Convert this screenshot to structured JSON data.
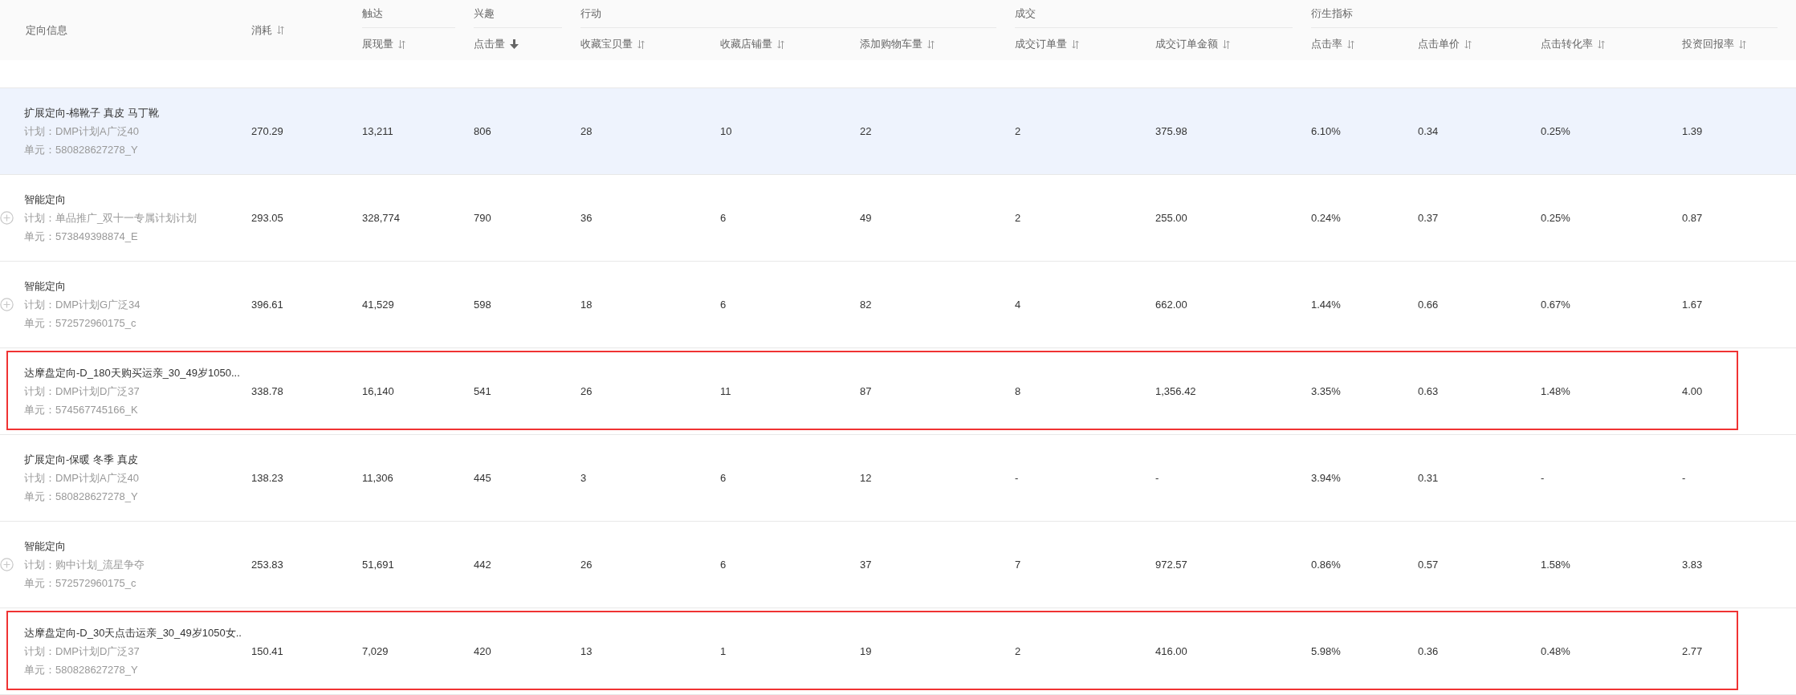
{
  "columns": [
    {
      "label": "定向信息",
      "sortable": false
    },
    {
      "label": "消耗",
      "sortable": true,
      "sorted_descending": false
    }
  ],
  "column_groups": [
    {
      "label": "触达",
      "columns": [
        {
          "label": "展现量",
          "sortable": true,
          "sorted_descending": false
        }
      ]
    },
    {
      "label": "兴趣",
      "columns": [
        {
          "label": "点击量",
          "sortable": true,
          "sorted_descending": true
        }
      ]
    },
    {
      "label": "行动",
      "columns": [
        {
          "label": "收藏宝贝量",
          "sortable": true,
          "sorted_descending": false
        },
        {
          "label": "收藏店铺量",
          "sortable": true,
          "sorted_descending": false
        },
        {
          "label": "添加购物车量",
          "sortable": true,
          "sorted_descending": false
        }
      ]
    },
    {
      "label": "成交",
      "columns": [
        {
          "label": "成交订单量",
          "sortable": true,
          "sorted_descending": false
        },
        {
          "label": "成交订单金额",
          "sortable": true,
          "sorted_descending": false
        }
      ]
    },
    {
      "label": "衍生指标",
      "columns": [
        {
          "label": "点击率",
          "sortable": true,
          "sorted_descending": false
        },
        {
          "label": "点击单价",
          "sortable": true,
          "sorted_descending": false
        },
        {
          "label": "点击转化率",
          "sortable": true,
          "sorted_descending": false
        },
        {
          "label": "投资回报率",
          "sortable": true,
          "sorted_descending": false
        }
      ]
    }
  ],
  "rows": [
    {
      "name": "扩展定向-棉靴子 真皮 马丁靴",
      "plan": "计划：DMP计划A广泛40",
      "unit": "单元：580828627278_Y",
      "expandable": false,
      "highlighted": true,
      "outlined": false,
      "values": [
        "270.29",
        "13,211",
        "806",
        "28",
        "10",
        "22",
        "2",
        "375.98",
        "6.10%",
        "0.34",
        "0.25%",
        "1.39"
      ]
    },
    {
      "name": "智能定向",
      "plan": "计划：单品推广_双十一专属计划计划",
      "unit": "单元：573849398874_E",
      "expandable": true,
      "highlighted": false,
      "outlined": false,
      "values": [
        "293.05",
        "328,774",
        "790",
        "36",
        "6",
        "49",
        "2",
        "255.00",
        "0.24%",
        "0.37",
        "0.25%",
        "0.87"
      ]
    },
    {
      "name": "智能定向",
      "plan": "计划：DMP计划G广泛34",
      "unit": "单元：572572960175_c",
      "expandable": true,
      "highlighted": false,
      "outlined": false,
      "values": [
        "396.61",
        "41,529",
        "598",
        "18",
        "6",
        "82",
        "4",
        "662.00",
        "1.44%",
        "0.66",
        "0.67%",
        "1.67"
      ]
    },
    {
      "name": "达摩盘定向-D_180天购买运亲_30_49岁1050...",
      "plan": "计划：DMP计划D广泛37",
      "unit": "单元：574567745166_K",
      "expandable": false,
      "highlighted": false,
      "outlined": true,
      "values": [
        "338.78",
        "16,140",
        "541",
        "26",
        "11",
        "87",
        "8",
        "1,356.42",
        "3.35%",
        "0.63",
        "1.48%",
        "4.00"
      ]
    },
    {
      "name": "扩展定向-保暖 冬季 真皮",
      "plan": "计划：DMP计划A广泛40",
      "unit": "单元：580828627278_Y",
      "expandable": false,
      "highlighted": false,
      "outlined": false,
      "values": [
        "138.23",
        "11,306",
        "445",
        "3",
        "6",
        "12",
        "-",
        "-",
        "3.94%",
        "0.31",
        "-",
        "-"
      ]
    },
    {
      "name": "智能定向",
      "plan": "计划：购中计划_流星争夺",
      "unit": "单元：572572960175_c",
      "expandable": true,
      "highlighted": false,
      "outlined": false,
      "values": [
        "253.83",
        "51,691",
        "442",
        "26",
        "6",
        "37",
        "7",
        "972.57",
        "0.86%",
        "0.57",
        "1.58%",
        "3.83"
      ]
    },
    {
      "name": "达摩盘定向-D_30天点击运亲_30_49岁1050女..",
      "plan": "计划：DMP计划D广泛37",
      "unit": "单元：580828627278_Y",
      "expandable": false,
      "highlighted": false,
      "outlined": true,
      "values": [
        "150.41",
        "7,029",
        "420",
        "13",
        "1",
        "19",
        "2",
        "416.00",
        "5.98%",
        "0.36",
        "0.48%",
        "2.77"
      ]
    }
  ]
}
